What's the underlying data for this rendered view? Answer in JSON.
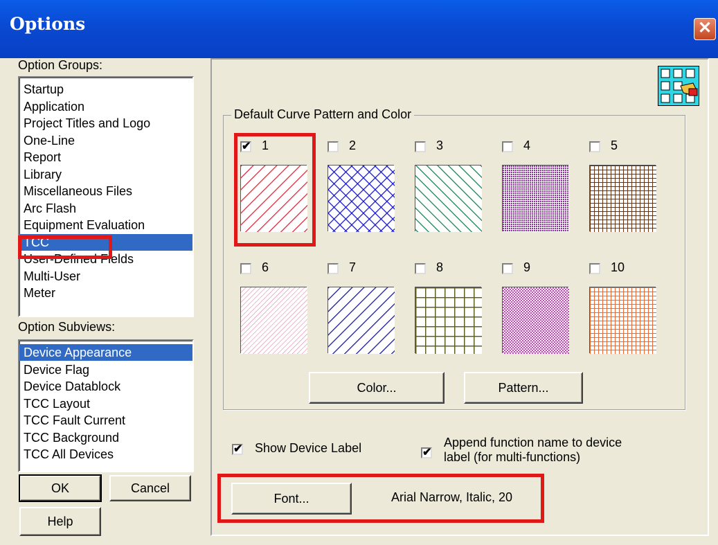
{
  "window": {
    "title": "Options",
    "close_glyph": "✕"
  },
  "left": {
    "groups_label": "Option Groups:",
    "groups": [
      "Startup",
      "Application",
      "Project Titles and Logo",
      "One-Line",
      "Report",
      "Library",
      "Miscellaneous Files",
      "Arc Flash",
      "Equipment Evaluation",
      "TCC",
      "User-Defined Fields",
      "Multi-User",
      "Meter"
    ],
    "selected_group": "TCC",
    "subviews_label": "Option Subviews:",
    "subviews": [
      "Device Appearance",
      "Device Flag",
      "Device Datablock",
      "TCC Layout",
      "TCC Fault Current",
      "TCC Background",
      "TCC All Devices"
    ],
    "selected_subview": "Device Appearance",
    "ok_label": "OK",
    "cancel_label": "Cancel",
    "help_label": "Help"
  },
  "main": {
    "group_title": "Default Curve Pattern and Color",
    "patterns": [
      {
        "label": "1",
        "checked": true,
        "style": "diag-right",
        "color": "#e02030"
      },
      {
        "label": "2",
        "checked": false,
        "style": "crosshatch",
        "color": "#1010d0"
      },
      {
        "label": "3",
        "checked": false,
        "style": "diag-left",
        "color": "#108050"
      },
      {
        "label": "4",
        "checked": false,
        "style": "dense",
        "color": "#9030a0"
      },
      {
        "label": "5",
        "checked": false,
        "style": "grid",
        "color": "#703010"
      },
      {
        "label": "6",
        "checked": false,
        "style": "fine-diag",
        "color": "#e07090"
      },
      {
        "label": "7",
        "checked": false,
        "style": "diag-right",
        "color": "#101090"
      },
      {
        "label": "8",
        "checked": false,
        "style": "grid-wide",
        "color": "#606020"
      },
      {
        "label": "9",
        "checked": false,
        "style": "dots",
        "color": "#d040c0"
      },
      {
        "label": "10",
        "checked": false,
        "style": "grid",
        "color": "#f06830"
      }
    ],
    "color_button": "Color...",
    "pattern_button": "Pattern...",
    "show_label_text": "Show Device Label",
    "show_label_checked": true,
    "append_text_1": "Append function name to device",
    "append_text_2": "label (for multi-functions)",
    "append_checked": true,
    "font_button": "Font...",
    "font_value": "Arial Narrow, Italic, 20"
  },
  "colors": {
    "accent": "#316ac5",
    "highlight": "#e01818",
    "titlebar": "#0a49d2"
  }
}
